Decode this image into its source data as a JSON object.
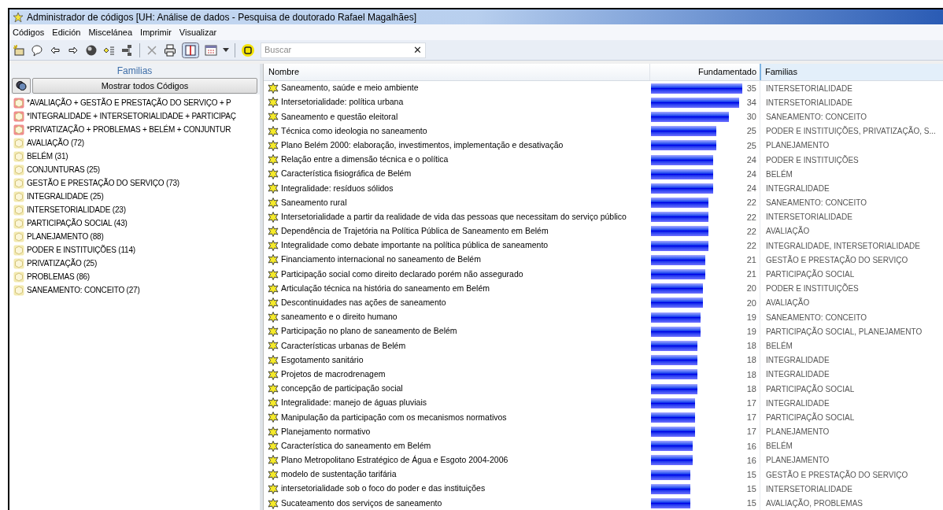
{
  "window": {
    "title": "Administrador de códigos [UH: Análise de dados - Pesquisa de doutorado Rafael Magalhães]"
  },
  "menu": [
    "Códigos",
    "Edición",
    "Miscelánea",
    "Imprimir",
    "Visualizar"
  ],
  "toolbar": {
    "search": {
      "placeholder": "Buscar"
    },
    "clear_icon": "✕"
  },
  "families_panel": {
    "title": "Familias",
    "show_all_button": "Mostrar todos Códigos",
    "items": [
      {
        "label": "*AVALIAÇÃO + GESTÃO E PRESTAÇÃO DO SERVIÇO + P",
        "kind": "combined"
      },
      {
        "label": "*INTEGRALIDADE + INTERSETORIALIDADE + PARTICIPAÇ",
        "kind": "combined"
      },
      {
        "label": "*PRIVATIZAÇÃO + PROBLEMAS + BELÉM + CONJUNTUR",
        "kind": "combined"
      },
      {
        "label": "AVALIAÇÃO (72)",
        "kind": "family"
      },
      {
        "label": "BELÉM (31)",
        "kind": "family"
      },
      {
        "label": "CONJUNTURAS (25)",
        "kind": "family"
      },
      {
        "label": "GESTÃO E PRESTAÇÃO DO SERVIÇO (73)",
        "kind": "family"
      },
      {
        "label": "INTEGRALIDADE (25)",
        "kind": "family"
      },
      {
        "label": "INTERSETORIALIDADE (23)",
        "kind": "family"
      },
      {
        "label": "PARTICIPAÇÃO SOCIAL (43)",
        "kind": "family"
      },
      {
        "label": "PLANEJAMENTO (88)",
        "kind": "family"
      },
      {
        "label": "PODER E INSTITUIÇÕES (114)",
        "kind": "family"
      },
      {
        "label": "PRIVATIZAÇÃO (25)",
        "kind": "family"
      },
      {
        "label": "PROBLEMAS (86)",
        "kind": "family"
      },
      {
        "label": "SANEAMENTO: CONCEITO (27)",
        "kind": "family"
      }
    ]
  },
  "table": {
    "columns": [
      "Nombre",
      "Fundamentado",
      "Familias"
    ],
    "rows": [
      {
        "name": "Saneamento, saúde e meio ambiente",
        "count": "35",
        "families": "INTERSETORIALIDADE"
      },
      {
        "name": "Intersetorialidade: política urbana",
        "count": "34",
        "families": "INTERSETORIALIDADE"
      },
      {
        "name": "Saneamento e questão eleitoral",
        "count": "30",
        "families": "SANEAMENTO: CONCEITO"
      },
      {
        "name": "Técnica como ideologia no saneamento",
        "count": "25",
        "families": "PODER E INSTITUIÇÕES, PRIVATIZAÇÃO, S..."
      },
      {
        "name": "Plano Belém 2000: elaboração, investimentos, implementação e desativação",
        "count": "25",
        "families": "PLANEJAMENTO"
      },
      {
        "name": "Relação entre a dimensão técnica e o política",
        "count": "24",
        "families": "PODER E INSTITUIÇÕES"
      },
      {
        "name": "Característica fisiográfica de Belém",
        "count": "24",
        "families": "BELÉM"
      },
      {
        "name": "Integralidade: resíduos sólidos",
        "count": "24",
        "families": "INTEGRALIDADE"
      },
      {
        "name": "Saneamento rural",
        "count": "22",
        "families": "SANEAMENTO: CONCEITO"
      },
      {
        "name": "Intersetorialidade a partir da realidade de vida das pessoas que necessitam do serviço público",
        "count": "22",
        "families": "INTERSETORIALIDADE"
      },
      {
        "name": "Dependência de Trajetória na Política Pública de Saneamento em Belém",
        "count": "22",
        "families": "AVALIAÇÃO"
      },
      {
        "name": "Integralidade como debate importante na política pública de saneamento",
        "count": "22",
        "families": "INTEGRALIDADE, INTERSETORIALIDADE"
      },
      {
        "name": "Financiamento internacional no saneamento de Belém",
        "count": "21",
        "families": "GESTÃO E PRESTAÇÃO DO SERVIÇO"
      },
      {
        "name": "Participação social como direito declarado porém não assegurado",
        "count": "21",
        "families": "PARTICIPAÇÃO SOCIAL"
      },
      {
        "name": "Articulação técnica na história do saneamento em Belém",
        "count": "20",
        "families": "PODER E INSTITUIÇÕES"
      },
      {
        "name": "Descontinuidades nas ações de saneamento",
        "count": "20",
        "families": "AVALIAÇÃO"
      },
      {
        "name": "saneamento e o direito humano",
        "count": "19",
        "families": "SANEAMENTO: CONCEITO"
      },
      {
        "name": "Participação no plano de saneamento de Belém",
        "count": "19",
        "families": "PARTICIPAÇÃO SOCIAL, PLANEJAMENTO"
      },
      {
        "name": "Características urbanas de Belém",
        "count": "18",
        "families": "BELÉM"
      },
      {
        "name": "Esgotamento sanitário",
        "count": "18",
        "families": "INTEGRALIDADE"
      },
      {
        "name": "Projetos de macrodrenagem",
        "count": "18",
        "families": "INTEGRALIDADE"
      },
      {
        "name": "concepção de participação social",
        "count": "18",
        "families": "PARTICIPAÇÃO SOCIAL"
      },
      {
        "name": "Integralidade: manejo de águas pluviais",
        "count": "17",
        "families": "INTEGRALIDADE"
      },
      {
        "name": "Manipulação da participação com os mecanismos normativos",
        "count": "17",
        "families": "PARTICIPAÇÃO SOCIAL"
      },
      {
        "name": "Planejamento normativo",
        "count": "17",
        "families": "PLANEJAMENTO"
      },
      {
        "name": "Característica do saneamento em Belém",
        "count": "16",
        "families": "BELÉM"
      },
      {
        "name": "Plano Metropolitano Estratégico de Água e Esgoto 2004-2006",
        "count": "16",
        "families": "PLANEJAMENTO"
      },
      {
        "name": "modelo de sustentação tarifária",
        "count": "15",
        "families": "GESTÃO E PRESTAÇÃO DO SERVIÇO"
      },
      {
        "name": "intersetorialidade sob o foco do poder e das instituições",
        "count": "15",
        "families": "INTERSETORIALIDADE"
      },
      {
        "name": "Sucateamento dos serviços de saneamento",
        "count": "15",
        "families": "AVALIAÇÃO, PROBLEMAS"
      }
    ]
  }
}
